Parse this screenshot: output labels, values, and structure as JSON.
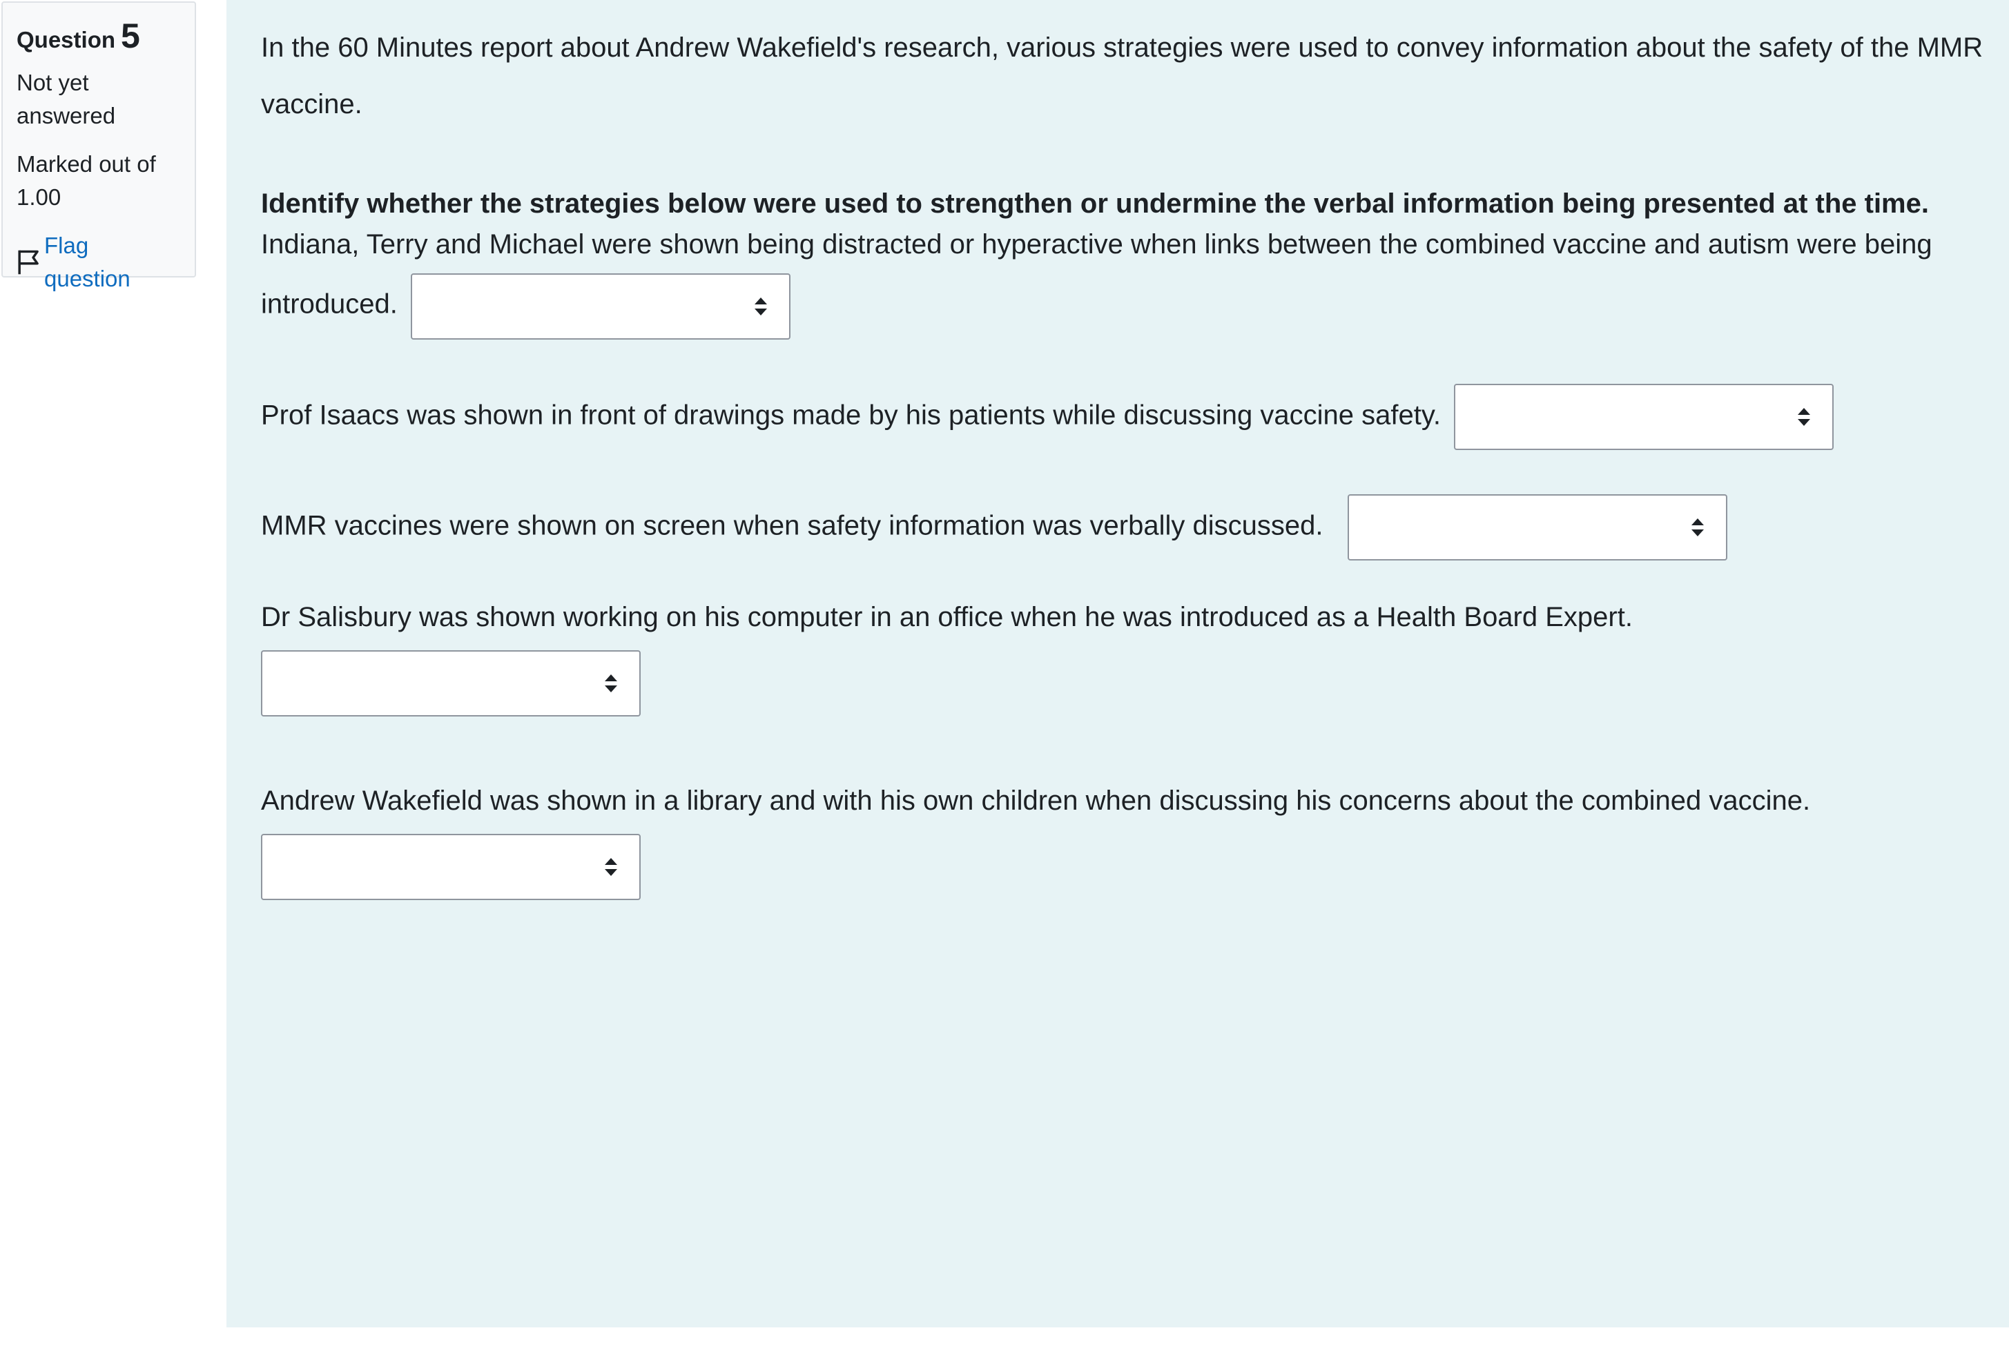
{
  "info": {
    "question_label": "Question",
    "question_number": "5",
    "state": "Not yet answered",
    "grade": "Marked out of 1.00",
    "flag_label": "Flag question"
  },
  "question": {
    "intro": "In the 60 Minutes report about Andrew Wakefield's research, various strategies were used to convey information about the safety of the MMR vaccine.",
    "instruction": "Identify whether the strategies below were used to strengthen or undermine the verbal information being presented at the time.",
    "items": [
      {
        "text": "Indiana, Terry and Michael were shown being distracted or hyperactive when links between the combined vaccine and autism were being introduced.",
        "selected": ""
      },
      {
        "text": "Prof Isaacs was shown in front of drawings made by his patients while discussing vaccine safety.",
        "selected": ""
      },
      {
        "text": "MMR vaccines were shown on screen when safety information was verbally discussed.",
        "selected": ""
      },
      {
        "text": "Dr Salisbury was shown working on his computer in an office when he was introduced as a Health Board Expert.",
        "selected": ""
      },
      {
        "text": "Andrew Wakefield was shown in a library and with his own children when discussing his concerns about the combined vaccine.",
        "selected": ""
      }
    ]
  },
  "colors": {
    "content_bg": "#e7f3f5",
    "info_bg": "#f8f9fa",
    "link": "#0f6cbf"
  }
}
